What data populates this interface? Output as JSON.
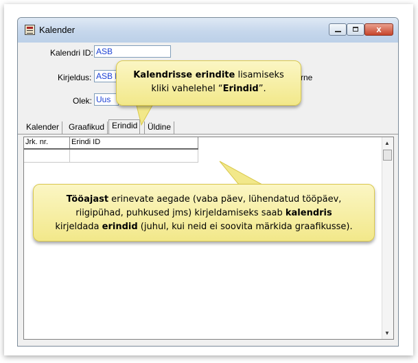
{
  "window": {
    "title": "Kalender",
    "close_symbol": "x"
  },
  "form": {
    "calendar_id_label": "Kalendri ID:",
    "calendar_id_value": "ASB",
    "description_label": "Kirjeldus:",
    "description_value": "ASB k",
    "description_trailing": "rne",
    "status_label": "Olek:",
    "status_value": "Uus"
  },
  "tabs": [
    {
      "label": "Kalender"
    },
    {
      "label": "Graafikud"
    },
    {
      "label": "Erindid",
      "active": true
    },
    {
      "label": "Üldine"
    }
  ],
  "grid": {
    "columns": [
      "Jrk. nr.",
      "Erindi ID"
    ],
    "rows": [
      [
        "",
        ""
      ]
    ]
  },
  "callouts": {
    "tip1": {
      "line1_bold": "Kalendrisse erindite",
      "line1_rest": " lisamiseks",
      "line2_pre": "kliki vahelehel “",
      "line2_bold": "Erindid",
      "line2_post": "”."
    },
    "tip2": {
      "line1_bold": "Tööajast",
      "line1_rest": " erinevate aegade (vaba päev, lühendatud tööpäev,",
      "line2": "riigipühad, puhkused jms) kirjeldamiseks saab ",
      "line2_bold": "kalendris",
      "line3_pre": "kirjeldada ",
      "line3_bold": "erindid",
      "line3_post": " (juhul, kui neid ei soovita märkida graafikusse)."
    }
  },
  "icons": {
    "app": "calendar-icon",
    "minimize": "minimize-icon",
    "maximize": "maximize-icon",
    "close": "close-icon",
    "scroll_up": "arrow-up-icon",
    "scroll_down": "arrow-down-icon"
  },
  "colors": {
    "callout_fill": "#f4eb97",
    "field_text": "#1a3fd4",
    "close_button": "#c7452b"
  }
}
